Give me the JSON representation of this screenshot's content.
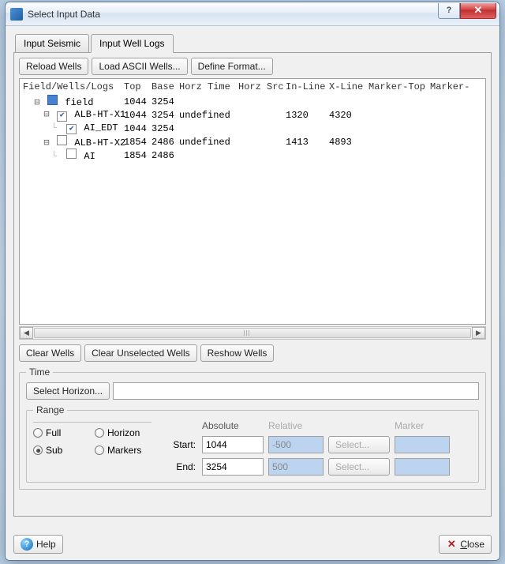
{
  "window": {
    "title": "Select Input Data"
  },
  "titlebar_buttons": {
    "help_glyph": "?",
    "close_glyph": "✕"
  },
  "tabs": [
    {
      "label": "Input Seismic",
      "active": false
    },
    {
      "label": "Input Well Logs",
      "active": true
    }
  ],
  "toolbar": {
    "reload": "Reload Wells",
    "load_ascii": "Load ASCII Wells...",
    "define_format": "Define Format..."
  },
  "tree": {
    "headers": [
      "Field/Wells/Logs",
      "Top",
      "Base",
      "Horz Time",
      "Horz Src",
      "In-Line",
      "X-Line",
      "Marker-Top",
      "Marker-"
    ],
    "rows": [
      {
        "indent": 0,
        "expander": "-",
        "check": "field",
        "name": "field",
        "top": "1044",
        "base": "3254",
        "ht": "",
        "hs": "",
        "il": "",
        "xl": ""
      },
      {
        "indent": 1,
        "expander": "-",
        "check": "on",
        "name": "ALB-HT-X1",
        "top": "1044",
        "base": "3254",
        "ht": "undefined",
        "hs": "",
        "il": "1320",
        "xl": "4320"
      },
      {
        "indent": 2,
        "expander": "",
        "check": "on",
        "name": "AI_EDT",
        "top": "1044",
        "base": "3254",
        "ht": "",
        "hs": "",
        "il": "",
        "xl": ""
      },
      {
        "indent": 1,
        "expander": "-",
        "check": "off",
        "name": "ALB-HT-X2",
        "top": "1854",
        "base": "2486",
        "ht": "undefined",
        "hs": "",
        "il": "1413",
        "xl": "4893"
      },
      {
        "indent": 2,
        "expander": "",
        "check": "off",
        "name": "AI",
        "top": "1854",
        "base": "2486",
        "ht": "",
        "hs": "",
        "il": "",
        "xl": ""
      }
    ]
  },
  "mid_buttons": {
    "clear": "Clear Wells",
    "clear_unselected": "Clear Unselected Wells",
    "reshow": "Reshow Wells"
  },
  "time": {
    "legend": "Time",
    "select_horizon": "Select Horizon...",
    "horizon_value": "",
    "range": {
      "legend": "Range",
      "options": {
        "full": "Full",
        "horizon": "Horizon",
        "sub": "Sub",
        "markers": "Markers"
      },
      "selected": "sub",
      "headers": {
        "absolute": "Absolute",
        "relative": "Relative",
        "marker": "Marker"
      },
      "start_label": "Start:",
      "end_label": "End:",
      "start_abs": "1044",
      "end_abs": "3254",
      "start_rel": "-500",
      "end_rel": "500",
      "select_btn": "Select..."
    }
  },
  "footer": {
    "help": "Help",
    "close": "Close",
    "close_prefix": "C"
  }
}
